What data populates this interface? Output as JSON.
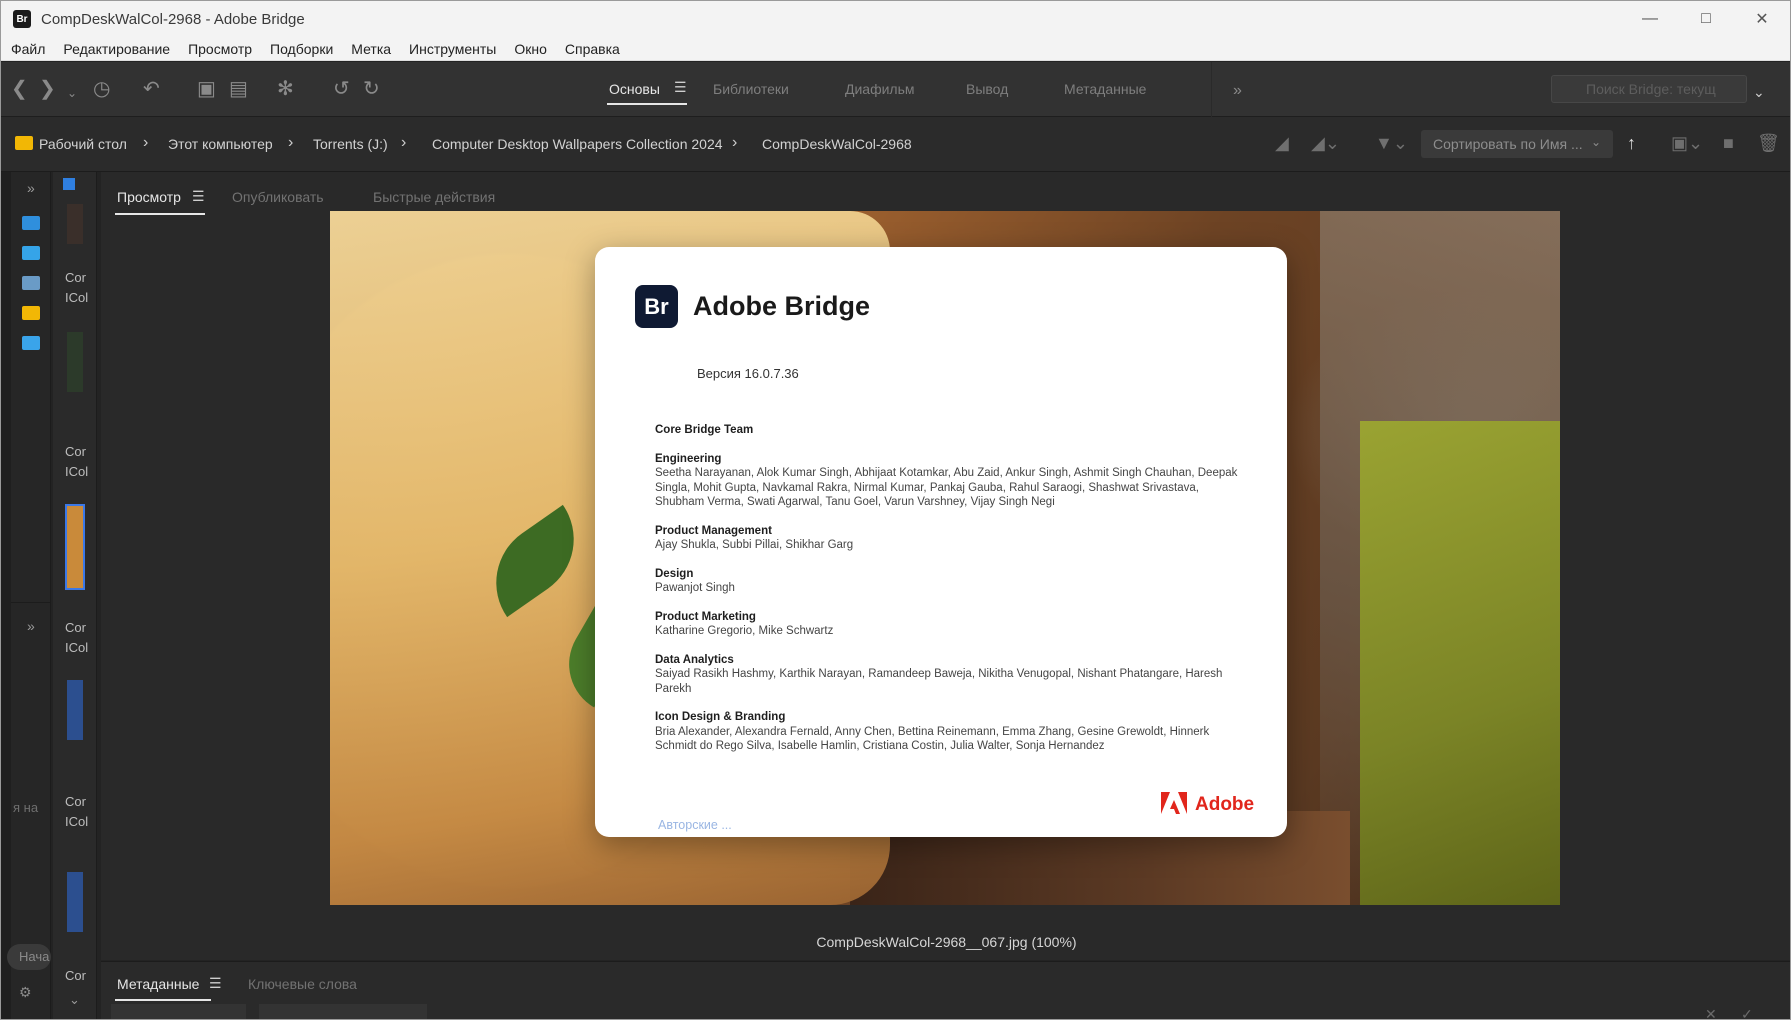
{
  "window": {
    "title": "CompDeskWalCol-2968 - Adobe Bridge",
    "app_icon_label": "Br"
  },
  "menu": [
    "Файл",
    "Редактирование",
    "Просмотр",
    "Подборки",
    "Метка",
    "Инструменты",
    "Окно",
    "Справка"
  ],
  "workspaces": {
    "active": "Основы",
    "tabs": [
      "Библиотеки",
      "Диафильм",
      "Вывод",
      "Метаданные"
    ]
  },
  "search": {
    "placeholder": "Поиск Bridge: текущ"
  },
  "path": {
    "crumbs": [
      "Рабочий стол",
      "Этот компьютер",
      "Torrents (J:)",
      "Computer Desktop Wallpapers Collection 2024",
      "CompDeskWalCol-2968"
    ]
  },
  "sort": {
    "label": "Сортировать по Имя ..."
  },
  "content_strip": {
    "labels": [
      "Cor\nICol",
      "Cor\nICol",
      "Cor\nICol",
      "Cor\nICol",
      "Cor"
    ]
  },
  "left_panel": {
    "partial_label": "я на",
    "button_label": "Нача"
  },
  "preview": {
    "tabs": [
      "Просмотр",
      "Опубликовать",
      "Быстрые действия"
    ],
    "caption": "CompDeskWalCol-2968__067.jpg (100%)"
  },
  "about": {
    "logo_text": "Br",
    "product": "Adobe Bridge",
    "version": "Версия 16.0.7.36",
    "team": "Core Bridge Team",
    "groups": [
      {
        "title": "Engineering",
        "names": "Seetha Narayanan, Alok Kumar Singh, Abhijaat Kotamkar, Abu Zaid, Ankur Singh, Ashmit Singh Chauhan, Deepak Singla, Mohit Gupta, Navkamal Rakra, Nirmal Kumar, Pankaj Gauba, Rahul Saraogi, Shashwat Srivastava, Shubham Verma, Swati Agarwal, Tanu Goel, Varun Varshney, Vijay Singh Negi"
      },
      {
        "title": "Product Management",
        "names": "Ajay Shukla, Subbi Pillai, Shikhar Garg"
      },
      {
        "title": "Design",
        "names": "Pawanjot Singh"
      },
      {
        "title": "Product Marketing",
        "names": "Katharine Gregorio, Mike Schwartz"
      },
      {
        "title": "Data Analytics",
        "names": "Saiyad Rasikh Hashmy, Karthik Narayan, Ramandeep Baweja, Nikitha Venugopal, Nishant Phatangare, Haresh Parekh"
      },
      {
        "title": "Icon Design & Branding",
        "names": "Bria Alexander, Alexandra Fernald, Anny Chen, Bettina Reinemann, Emma Zhang, Gesine Grewoldt, Hinnerk Schmidt do Rego Silva, Isabelle Hamlin, Cristiana Costin, Julia Walter, Sonja Hernandez"
      }
    ],
    "legal_link": "Авторские ...",
    "brand": "Adobe",
    "brand_color": "#e1261c"
  },
  "bottom_panel": {
    "tabs": [
      "Метаданные",
      "Ключевые слова"
    ]
  }
}
